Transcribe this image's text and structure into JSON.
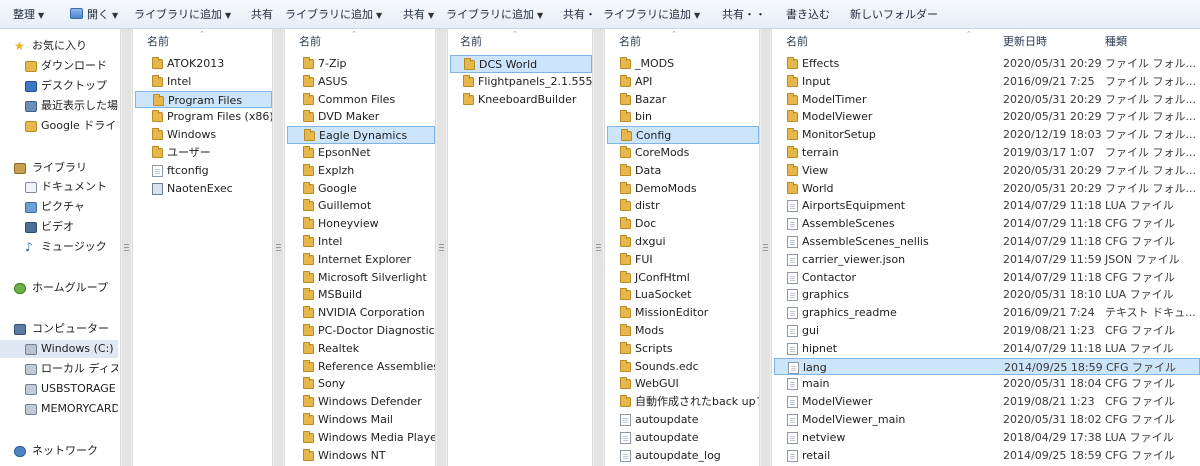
{
  "toolbar": {
    "organize": "整理",
    "open": "開く",
    "add_library": "ライブラリに追加",
    "share": "共有",
    "share_dot": "共有・",
    "share_dots": "共有・・",
    "burn": "書き込む",
    "new_folder": "新しいフォルダー"
  },
  "nav": {
    "favorites": "お気に入り",
    "fav_items": [
      "ダウンロード",
      "デスクトップ",
      "最近表示した場所",
      "Google ドライブ"
    ],
    "libraries": "ライブラリ",
    "lib_items": [
      "ドキュメント",
      "ピクチャ",
      "ビデオ",
      "ミュージック"
    ],
    "homegroup": "ホームグループ",
    "computer": "コンピューター",
    "comp_items": [
      "Windows (C:)",
      "ローカル ディスク",
      "USBSTORAGE (",
      "MEMORYCARD"
    ],
    "network": "ネットワーク"
  },
  "headers": {
    "name": "名前",
    "date": "更新日時",
    "type": "種類"
  },
  "col1": [
    "ATOK2013",
    "Intel",
    "Program Files",
    "Program Files (x86)",
    "Windows",
    "ユーザー",
    "ftconfig",
    "NaotenExec"
  ],
  "col2": [
    "7-Zip",
    "ASUS",
    "Common Files",
    "DVD Maker",
    "Eagle Dynamics",
    "EpsonNet",
    "Explzh",
    "Google",
    "Guillemot",
    "Honeyview",
    "Intel",
    "Internet Explorer",
    "Microsoft Silverlight",
    "MSBuild",
    "NVIDIA Corporation",
    "PC-Doctor Diagnostics",
    "Realtek",
    "Reference Assemblies",
    "Sony",
    "Windows Defender",
    "Windows Mail",
    "Windows Media Player",
    "Windows NT"
  ],
  "col3": [
    "DCS World",
    "Flightpanels_2.1.555",
    "KneeboardBuilder"
  ],
  "col4": [
    "_MODS",
    "API",
    "Bazar",
    "bin",
    "Config",
    "CoreMods",
    "Data",
    "DemoMods",
    "distr",
    "Doc",
    "dxgui",
    "FUI",
    "JConfHtml",
    "LuaSocket",
    "MissionEditor",
    "Mods",
    "Scripts",
    "Sounds.edc",
    "WebGUI",
    "自動作成されたback upフ",
    "autoupdate",
    "autoupdate",
    "autoupdate_log"
  ],
  "col5": [
    {
      "name": "Effects",
      "date": "2020/05/31 20:29",
      "type": "ファイル フォル..."
    },
    {
      "name": "Input",
      "date": "2016/09/21 7:25",
      "type": "ファイル フォル..."
    },
    {
      "name": "ModelTimer",
      "date": "2020/05/31 20:29",
      "type": "ファイル フォル..."
    },
    {
      "name": "ModelViewer",
      "date": "2020/05/31 20:29",
      "type": "ファイル フォル..."
    },
    {
      "name": "MonitorSetup",
      "date": "2020/12/19 18:03",
      "type": "ファイル フォル..."
    },
    {
      "name": "terrain",
      "date": "2019/03/17 1:07",
      "type": "ファイル フォル..."
    },
    {
      "name": "View",
      "date": "2020/05/31 20:29",
      "type": "ファイル フォル..."
    },
    {
      "name": "World",
      "date": "2020/05/31 20:29",
      "type": "ファイル フォル..."
    },
    {
      "name": "AirportsEquipment",
      "date": "2014/07/29 11:18",
      "type": "LUA ファイル"
    },
    {
      "name": "AssembleScenes",
      "date": "2014/07/29 11:18",
      "type": "CFG ファイル"
    },
    {
      "name": "AssembleScenes_nellis",
      "date": "2014/07/29 11:18",
      "type": "CFG ファイル"
    },
    {
      "name": "carrier_viewer.json",
      "date": "2014/07/29 11:59",
      "type": "JSON ファイル"
    },
    {
      "name": "Contactor",
      "date": "2014/07/29 11:18",
      "type": "CFG ファイル"
    },
    {
      "name": "graphics",
      "date": "2020/05/31 18:10",
      "type": "LUA ファイル"
    },
    {
      "name": "graphics_readme",
      "date": "2016/09/21 7:24",
      "type": "テキスト ドキュ..."
    },
    {
      "name": "gui",
      "date": "2019/08/21 1:23",
      "type": "CFG ファイル"
    },
    {
      "name": "hipnet",
      "date": "2014/07/29 11:18",
      "type": "LUA ファイル"
    },
    {
      "name": "lang",
      "date": "2014/09/25 18:59",
      "type": "CFG ファイル"
    },
    {
      "name": "main",
      "date": "2020/05/31 18:04",
      "type": "CFG ファイル"
    },
    {
      "name": "ModelViewer",
      "date": "2019/08/21 1:23",
      "type": "CFG ファイル"
    },
    {
      "name": "ModelViewer_main",
      "date": "2020/05/31 18:02",
      "type": "CFG ファイル"
    },
    {
      "name": "netview",
      "date": "2018/04/29 17:38",
      "type": "LUA ファイル"
    },
    {
      "name": "retail",
      "date": "2014/09/25 18:59",
      "type": "CFG ファイル"
    }
  ]
}
